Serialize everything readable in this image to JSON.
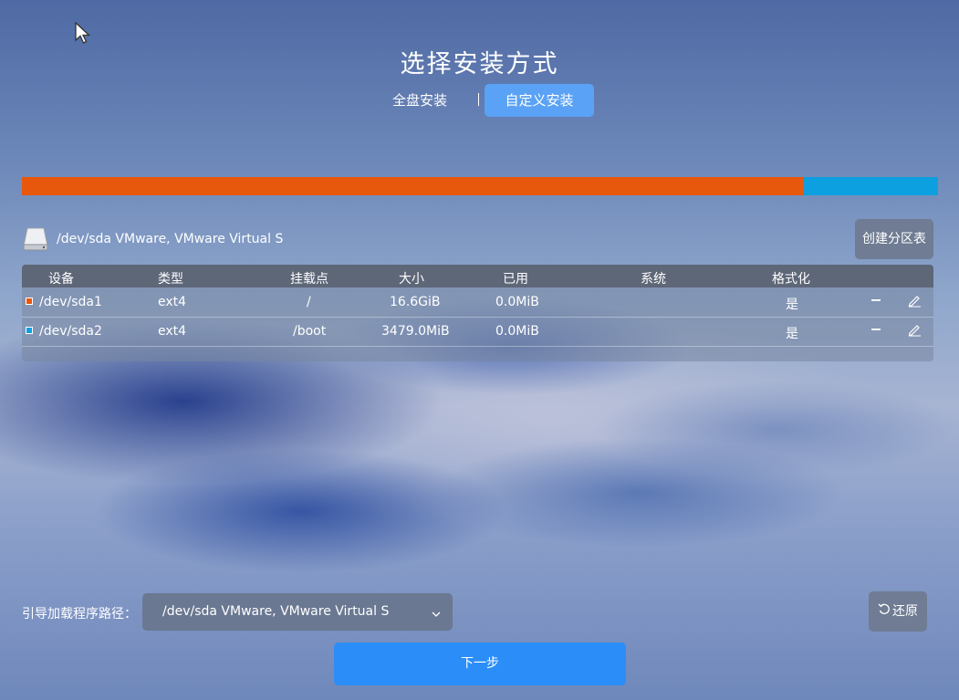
{
  "page": {
    "title": "选择安装方式"
  },
  "tabs": [
    {
      "label": "全盘安装",
      "active": false
    },
    {
      "label": "自定义安装",
      "active": true
    }
  ],
  "usage_bar": {
    "segments": [
      {
        "device": "/dev/sda1",
        "fraction": 0.853,
        "color": "#e8580c"
      },
      {
        "device": "/dev/sda2",
        "fraction": 0.147,
        "color": "#0da0e0"
      }
    ]
  },
  "disk": {
    "label": "/dev/sda VMware, VMware Virtual S",
    "icon": "hard-disk-icon"
  },
  "create_table_button": "创建分区表",
  "table": {
    "headers": {
      "device": "设备",
      "type": "类型",
      "mount": "挂载点",
      "size": "大小",
      "used": "已用",
      "system": "系统",
      "format": "格式化"
    },
    "rows": [
      {
        "device": "/dev/sda1",
        "type": "ext4",
        "mount": "/",
        "size": "16.6GiB",
        "used": "0.0MiB",
        "system": "",
        "format": "是",
        "color": "#e8580c"
      },
      {
        "device": "/dev/sda2",
        "type": "ext4",
        "mount": "/boot",
        "size": "3479.0MiB",
        "used": "0.0MiB",
        "system": "",
        "format": "是",
        "color": "#0da0e0"
      }
    ]
  },
  "boot": {
    "label": "引导加载程序路径：",
    "value": "/dev/sda VMware, VMware Virtual S"
  },
  "restore_button": "还原",
  "next_button": "下一步"
}
